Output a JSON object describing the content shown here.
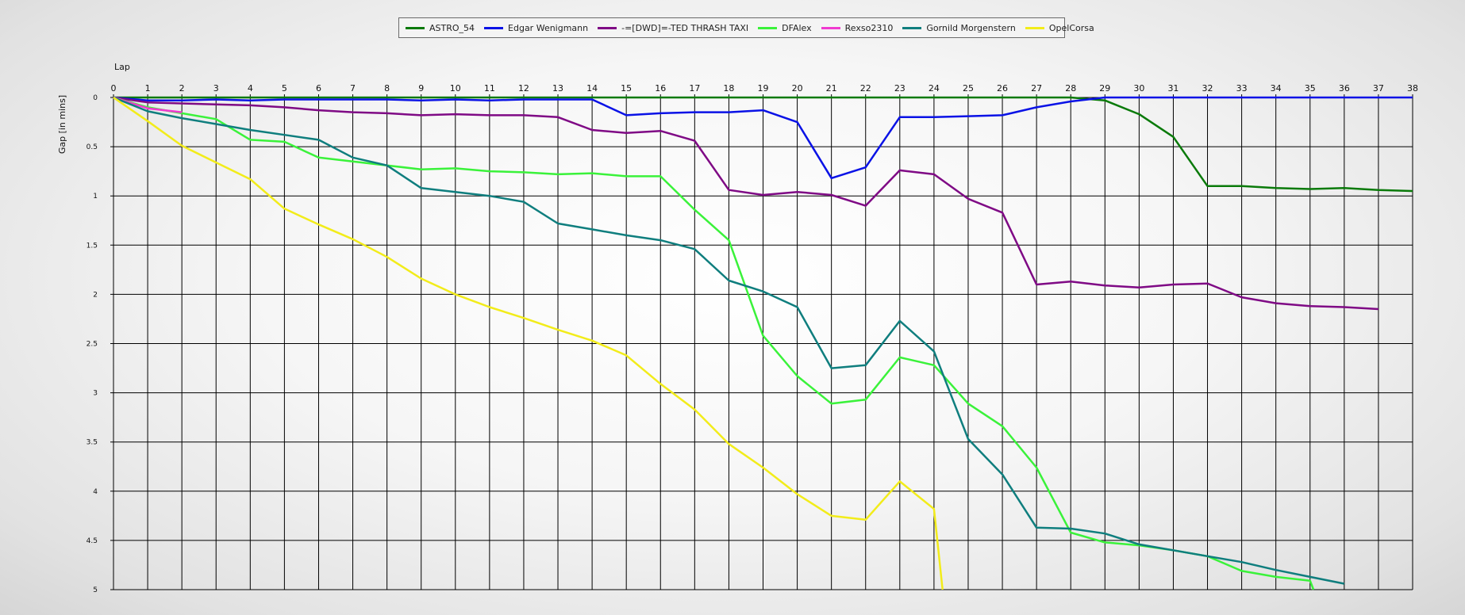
{
  "chart_data": {
    "type": "line",
    "xlabel": "Lap",
    "ylabel": "Gap [in mins]",
    "x_ticks": [
      0,
      1,
      2,
      3,
      4,
      5,
      6,
      7,
      8,
      9,
      10,
      11,
      12,
      13,
      14,
      15,
      16,
      17,
      18,
      19,
      20,
      21,
      22,
      23,
      24,
      25,
      26,
      27,
      28,
      29,
      30,
      31,
      32,
      33,
      34,
      35,
      36,
      37,
      38
    ],
    "y_ticks": [
      0,
      0.5,
      1,
      1.5,
      2,
      2.5,
      3,
      3.5,
      4,
      4.5,
      5
    ],
    "y_tick_labels": [
      "0",
      "0.5",
      "1",
      "1.5",
      "2",
      "2.5",
      "3",
      "3.5",
      "4",
      "4.5",
      "5"
    ],
    "xlim": [
      0,
      38
    ],
    "ylim": [
      0,
      5
    ],
    "y_inverted": true,
    "grid": true,
    "legend_position": "top-center",
    "series": [
      {
        "name": "ASTRO_54",
        "color": "#0a7a0a",
        "x": [
          0,
          1,
          2,
          3,
          4,
          5,
          6,
          7,
          8,
          9,
          10,
          11,
          12,
          13,
          14,
          15,
          16,
          17,
          18,
          19,
          20,
          21,
          22,
          23,
          24,
          25,
          26,
          27,
          28,
          29,
          30,
          31,
          32,
          33,
          34,
          35,
          36,
          37,
          38
        ],
        "y": [
          0,
          0,
          0,
          0,
          0,
          0,
          0,
          0,
          0,
          0,
          0,
          0,
          0,
          0,
          0,
          0,
          0,
          0,
          0,
          0,
          0,
          0,
          0,
          0,
          0,
          0,
          0,
          0,
          0,
          0.03,
          0.17,
          0.4,
          0.9,
          0.9,
          0.92,
          0.93,
          0.92,
          0.94,
          0.95
        ]
      },
      {
        "name": "Edgar Wenigmann",
        "color": "#0a12e6",
        "x": [
          0,
          1,
          2,
          3,
          4,
          5,
          6,
          7,
          8,
          9,
          10,
          11,
          12,
          13,
          14,
          15,
          16,
          17,
          18,
          19,
          20,
          21,
          22,
          23,
          24,
          25,
          26,
          27,
          28,
          29,
          30,
          31,
          32,
          33,
          34,
          35,
          36,
          37,
          38
        ],
        "y": [
          0,
          0.03,
          0.03,
          0.02,
          0.03,
          0.02,
          0.02,
          0.02,
          0.02,
          0.03,
          0.02,
          0.03,
          0.02,
          0.02,
          0.02,
          0.18,
          0.16,
          0.15,
          0.15,
          0.13,
          0.25,
          0.82,
          0.71,
          0.2,
          0.2,
          0.19,
          0.18,
          0.1,
          0.04,
          0,
          0,
          0,
          0,
          0,
          0,
          0,
          0,
          0,
          0
        ]
      },
      {
        "name": "-=[DWD]=-TED THRASH TAXI",
        "color": "#7f0a85",
        "x": [
          0,
          1,
          2,
          3,
          4,
          5,
          6,
          7,
          8,
          9,
          10,
          11,
          12,
          13,
          14,
          15,
          16,
          17,
          18,
          19,
          20,
          21,
          22,
          23,
          24,
          25,
          26,
          27,
          28,
          29,
          30,
          31,
          32,
          33,
          34,
          35,
          36,
          37
        ],
        "y": [
          0,
          0.05,
          0.06,
          0.07,
          0.08,
          0.1,
          0.13,
          0.15,
          0.16,
          0.18,
          0.17,
          0.18,
          0.18,
          0.2,
          0.33,
          0.36,
          0.34,
          0.44,
          0.94,
          0.99,
          0.96,
          0.99,
          1.1,
          0.74,
          0.78,
          1.03,
          1.17,
          1.9,
          1.87,
          1.91,
          1.93,
          1.9,
          1.89,
          2.03,
          2.09,
          2.12,
          2.13,
          2.15
        ]
      },
      {
        "name": "DFAlex",
        "color": "#3af23a",
        "x": [
          0,
          1,
          2,
          3,
          4,
          5,
          6,
          7,
          8,
          9,
          10,
          11,
          12,
          13,
          14,
          15,
          16,
          17,
          18,
          19,
          20,
          21,
          22,
          23,
          24,
          25,
          26,
          27,
          28,
          29,
          30,
          31,
          32,
          33,
          34,
          35,
          35.1
        ],
        "y": [
          0,
          0.1,
          0.16,
          0.22,
          0.43,
          0.45,
          0.61,
          0.65,
          0.69,
          0.73,
          0.72,
          0.75,
          0.76,
          0.78,
          0.77,
          0.8,
          0.8,
          1.14,
          1.45,
          2.42,
          2.83,
          3.11,
          3.07,
          2.64,
          2.72,
          3.11,
          3.34,
          3.76,
          4.42,
          4.52,
          4.55,
          4.6,
          4.66,
          4.81,
          4.87,
          4.91,
          5.0
        ]
      },
      {
        "name": "Rexso2310",
        "color": "#f03ad0",
        "x": [
          0,
          1,
          2
        ],
        "y": [
          0,
          0.11,
          0.15
        ]
      },
      {
        "name": "Gornild Morgenstern",
        "color": "#0f7e7e",
        "x": [
          0,
          1,
          2,
          3,
          4,
          5,
          6,
          7,
          8,
          9,
          10,
          11,
          12,
          13,
          14,
          15,
          16,
          17,
          18,
          19,
          20,
          21,
          22,
          23,
          24,
          25,
          26,
          27,
          28,
          29,
          30,
          31,
          32,
          33,
          34,
          35,
          36
        ],
        "y": [
          0,
          0.14,
          0.21,
          0.27,
          0.33,
          0.38,
          0.43,
          0.61,
          0.69,
          0.92,
          0.96,
          1.0,
          1.06,
          1.28,
          1.34,
          1.4,
          1.45,
          1.54,
          1.86,
          1.97,
          2.13,
          2.75,
          2.72,
          2.27,
          2.58,
          3.47,
          3.83,
          4.37,
          4.38,
          4.43,
          4.54,
          4.6,
          4.66,
          4.72,
          4.8,
          4.87,
          4.94
        ]
      },
      {
        "name": "OpelCorsa",
        "color": "#f2ec1a",
        "x": [
          0,
          1,
          2,
          3,
          4,
          5,
          6,
          7,
          8,
          9,
          10,
          11,
          12,
          13,
          14,
          15,
          16,
          17,
          18,
          19,
          20,
          21,
          22,
          23,
          24,
          24.25
        ],
        "y": [
          0,
          0.24,
          0.49,
          0.66,
          0.83,
          1.13,
          1.29,
          1.44,
          1.62,
          1.84,
          2.0,
          2.13,
          2.24,
          2.36,
          2.47,
          2.62,
          2.91,
          3.17,
          3.52,
          3.76,
          4.03,
          4.25,
          4.29,
          3.9,
          4.18,
          5.0
        ]
      }
    ]
  }
}
